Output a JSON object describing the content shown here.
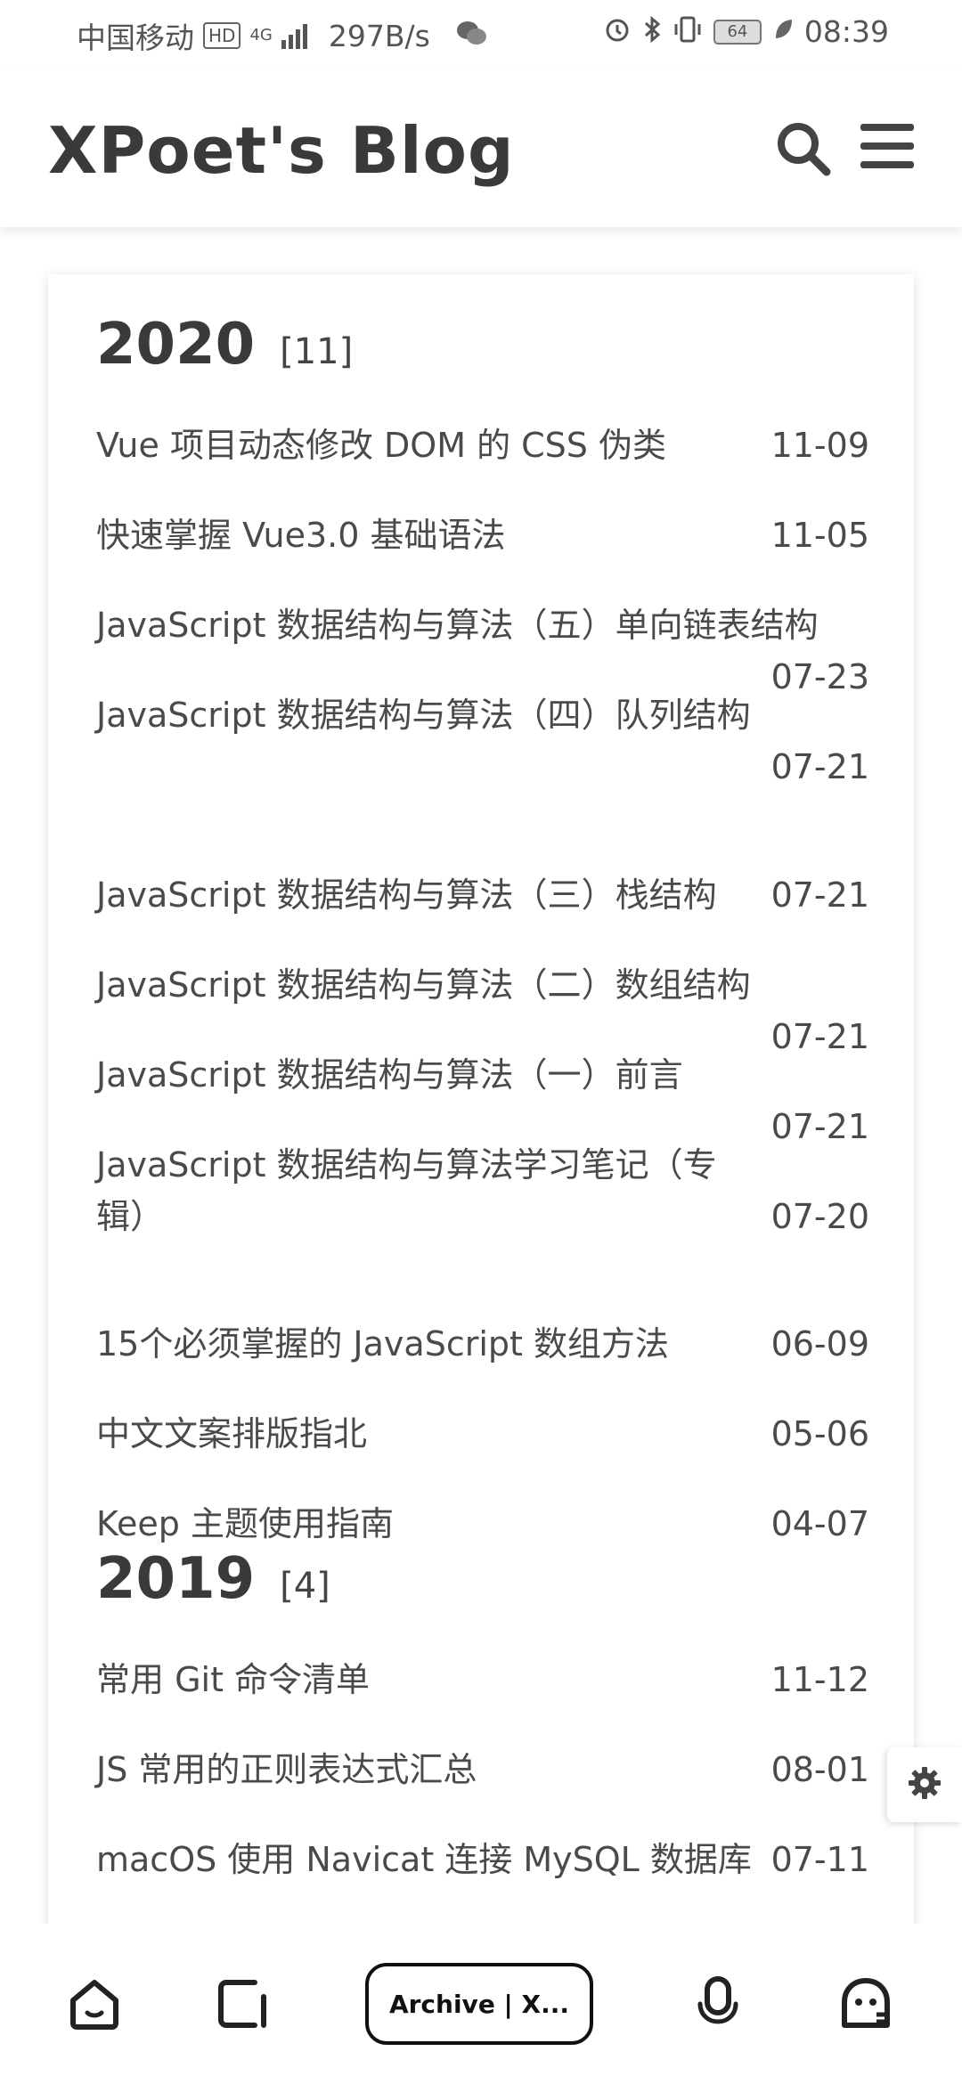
{
  "status_bar": {
    "carrier": "中国移动",
    "hd": "HD",
    "network": "4G",
    "speed": "297B/s",
    "battery": "64",
    "time": "08:39",
    "icons": [
      "wechat-icon",
      "alarm-icon",
      "bluetooth-icon",
      "vibrate-icon",
      "leaf-icon"
    ]
  },
  "header": {
    "title": "XPoet's Blog",
    "icons": [
      "search-icon",
      "menu-icon"
    ]
  },
  "archive": {
    "years": [
      {
        "year": "2020",
        "count": "[11]",
        "posts": [
          {
            "title": "Vue 项目动态修改 DOM 的 CSS 伪类",
            "date": "11-09"
          },
          {
            "title": "快速掌握 Vue3.0 基础语法",
            "date": "11-05"
          },
          {
            "title": "JavaScript 数据结构与算法（五）单向链表结构",
            "date": "07-23"
          },
          {
            "title": "JavaScript 数据结构与算法（四）队列结构",
            "date": "07-21"
          },
          {
            "title": "JavaScript 数据结构与算法（三）栈结构",
            "date": "07-21"
          },
          {
            "title": "JavaScript 数据结构与算法（二）数组结构",
            "date": "07-21"
          },
          {
            "title": "JavaScript 数据结构与算法（一）前言",
            "date": "07-21"
          },
          {
            "title": "JavaScript 数据结构与算法学习笔记（专辑）",
            "date": "07-20"
          },
          {
            "title": "15个必须掌握的 JavaScript 数组方法",
            "date": "06-09"
          },
          {
            "title": "中文文案排版指北",
            "date": "05-06"
          },
          {
            "title": "Keep 主题使用指南",
            "date": "04-07"
          }
        ]
      },
      {
        "year": "2019",
        "count": "[4]",
        "posts": [
          {
            "title": "常用 Git 命令清单",
            "date": "11-12"
          },
          {
            "title": "JS 常用的正则表达式汇总",
            "date": "08-01"
          },
          {
            "title": "macOS 使用 Navicat 连接 MySQL 数据库",
            "date": "07-11"
          }
        ]
      }
    ]
  },
  "settings": {
    "icon": "gear-icon"
  },
  "bottom_nav": {
    "tab_label": "Archive | X...",
    "icons": [
      "home-icon",
      "tabs-icon",
      "microphone-icon",
      "assistant-icon"
    ]
  }
}
